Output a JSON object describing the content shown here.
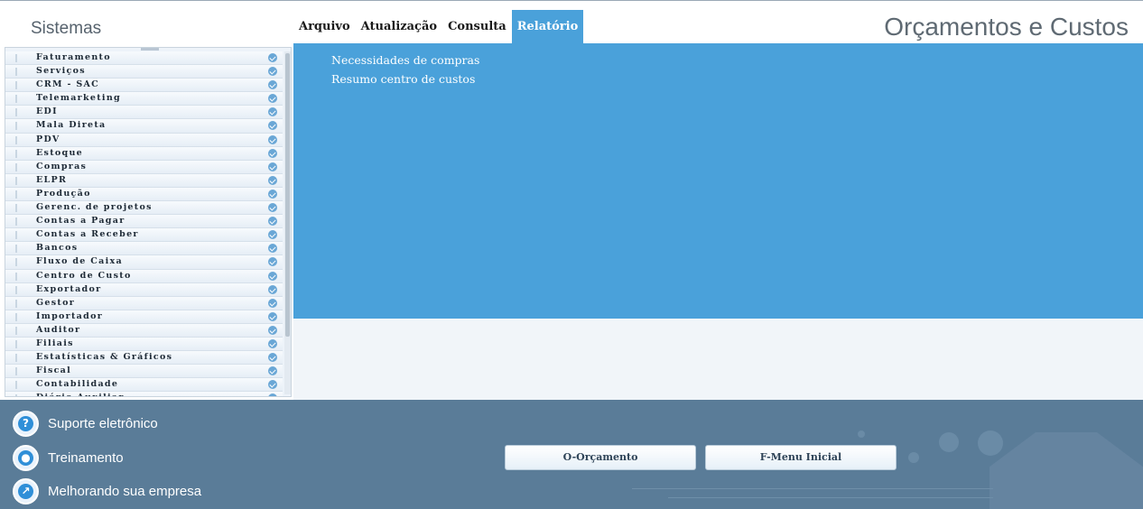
{
  "header": {
    "sidebar_title": "Sistemas",
    "app_title": "Orçamentos e Custos"
  },
  "menu": [
    {
      "label": "Arquivo",
      "active": false
    },
    {
      "label": "Atualização",
      "active": false
    },
    {
      "label": "Consulta",
      "active": false
    },
    {
      "label": "Relatório",
      "active": true
    }
  ],
  "sidebar": {
    "items": [
      "Faturamento",
      "Serviços",
      "CRM - SAC",
      "Telemarketing",
      "EDI",
      "Mala Direta",
      "PDV",
      "Estoque",
      "Compras",
      "ELPR",
      "Produção",
      "Gerenc. de projetos",
      "Contas a Pagar",
      "Contas a Receber",
      "Bancos",
      "Fluxo de Caixa",
      "Centro de Custo",
      "Exportador",
      "Gestor",
      "Importador",
      "Auditor",
      "Filiais",
      "Estatísticas & Gráficos",
      "Fiscal",
      "Contabilidade",
      "Diário Auxiliar"
    ]
  },
  "submenu": {
    "items": [
      "Necessidades de compras",
      "Resumo centro de custos"
    ]
  },
  "footer": {
    "links": [
      "Suporte eletrônico",
      "Treinamento",
      "Melhorando sua empresa"
    ],
    "buttons": [
      "O-Orçamento",
      "F-Menu Inicial"
    ]
  },
  "colors": {
    "accent": "#4aa1da",
    "footer": "#5a7c98"
  }
}
